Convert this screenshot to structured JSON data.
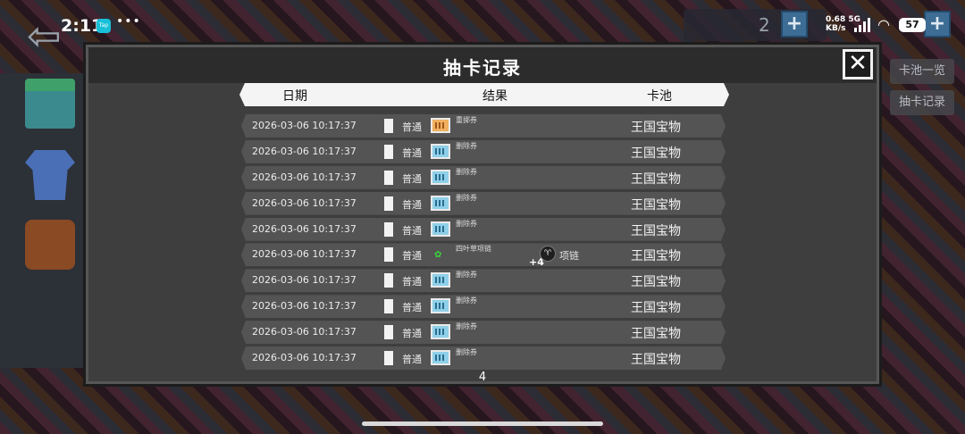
{
  "status_bar": {
    "time": "2:11",
    "app_badge": "Tap",
    "dots": "•••",
    "net_speed": "0.68",
    "net_type": "5G",
    "net_unit": "KB/s",
    "battery": "57"
  },
  "top_hud": {
    "currency_value": "2",
    "plus": "+"
  },
  "side_tabs": [
    "卡池一览",
    "抽卡记录"
  ],
  "dialog": {
    "title": "抽卡记录",
    "close": "✕",
    "columns": {
      "date": "日期",
      "result": "结果",
      "pool": "卡池"
    },
    "page": "4",
    "rows": [
      {
        "date": "2026-03-06 10:17:37",
        "rarity": "普通",
        "icon": "ticket-orange-icon",
        "item": "重掷券",
        "pool": "王国宝物"
      },
      {
        "date": "2026-03-06 10:17:37",
        "rarity": "普通",
        "icon": "ticket-blue-icon",
        "item": "删除券",
        "pool": "王国宝物"
      },
      {
        "date": "2026-03-06 10:17:37",
        "rarity": "普通",
        "icon": "ticket-blue-icon",
        "item": "删除券",
        "pool": "王国宝物"
      },
      {
        "date": "2026-03-06 10:17:37",
        "rarity": "普通",
        "icon": "ticket-blue-icon",
        "item": "删除券",
        "pool": "王国宝物"
      },
      {
        "date": "2026-03-06 10:17:37",
        "rarity": "普通",
        "icon": "ticket-blue-icon",
        "item": "删除券",
        "pool": "王国宝物"
      },
      {
        "date": "2026-03-06 10:17:37",
        "rarity": "普通",
        "icon": "clover-icon",
        "item": "四叶草项链",
        "extra_plus": "+4",
        "extra_name": "项链",
        "pool": "王国宝物"
      },
      {
        "date": "2026-03-06 10:17:37",
        "rarity": "普通",
        "icon": "ticket-blue-icon",
        "item": "删除券",
        "pool": "王国宝物"
      },
      {
        "date": "2026-03-06 10:17:37",
        "rarity": "普通",
        "icon": "ticket-blue-icon",
        "item": "删除券",
        "pool": "王国宝物"
      },
      {
        "date": "2026-03-06 10:17:37",
        "rarity": "普通",
        "icon": "ticket-blue-icon",
        "item": "删除券",
        "pool": "王国宝物"
      },
      {
        "date": "2026-03-06 10:17:37",
        "rarity": "普通",
        "icon": "ticket-blue-icon",
        "item": "删除券",
        "pool": "王国宝物"
      }
    ]
  },
  "nav": {
    "prev": "‹",
    "next": "›"
  },
  "colors": {
    "dialog_bg": "#3e3e3e",
    "row_bg": "#545454",
    "header_bg": "#f4f4f4"
  }
}
